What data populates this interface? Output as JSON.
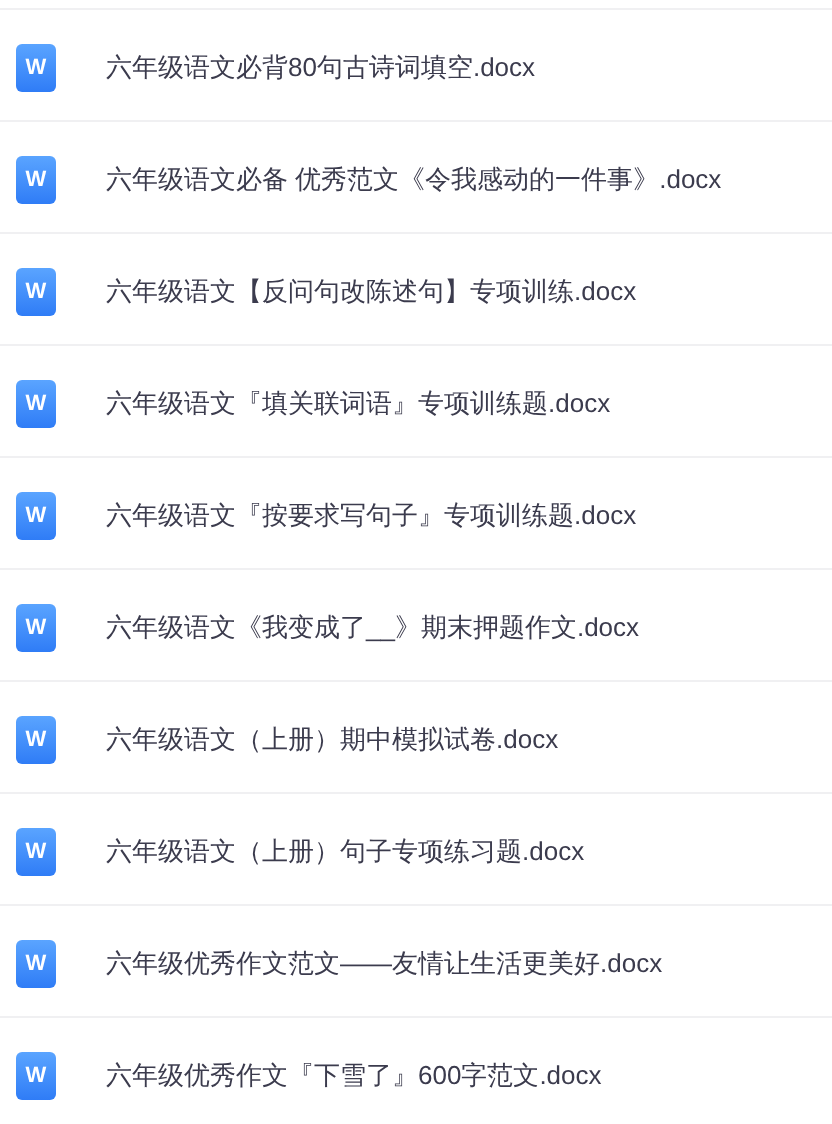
{
  "files": [
    {
      "icon_label": "W",
      "name": "六年级语文必背80句古诗词填空.docx"
    },
    {
      "icon_label": "W",
      "name": "六年级语文必备 优秀范文《令我感动的一件事》.docx"
    },
    {
      "icon_label": "W",
      "name": "六年级语文【反问句改陈述句】专项训练.docx"
    },
    {
      "icon_label": "W",
      "name": "六年级语文『填关联词语』专项训练题.docx"
    },
    {
      "icon_label": "W",
      "name": "六年级语文『按要求写句子』专项训练题.docx"
    },
    {
      "icon_label": "W",
      "name": "六年级语文《我变成了__》期末押题作文.docx"
    },
    {
      "icon_label": "W",
      "name": "六年级语文（上册）期中模拟试卷.docx"
    },
    {
      "icon_label": "W",
      "name": "六年级语文（上册）句子专项练习题.docx"
    },
    {
      "icon_label": "W",
      "name": "六年级优秀作文范文——友情让生活更美好.docx"
    },
    {
      "icon_label": "W",
      "name": "六年级优秀作文『下雪了』600字范文.docx"
    }
  ]
}
